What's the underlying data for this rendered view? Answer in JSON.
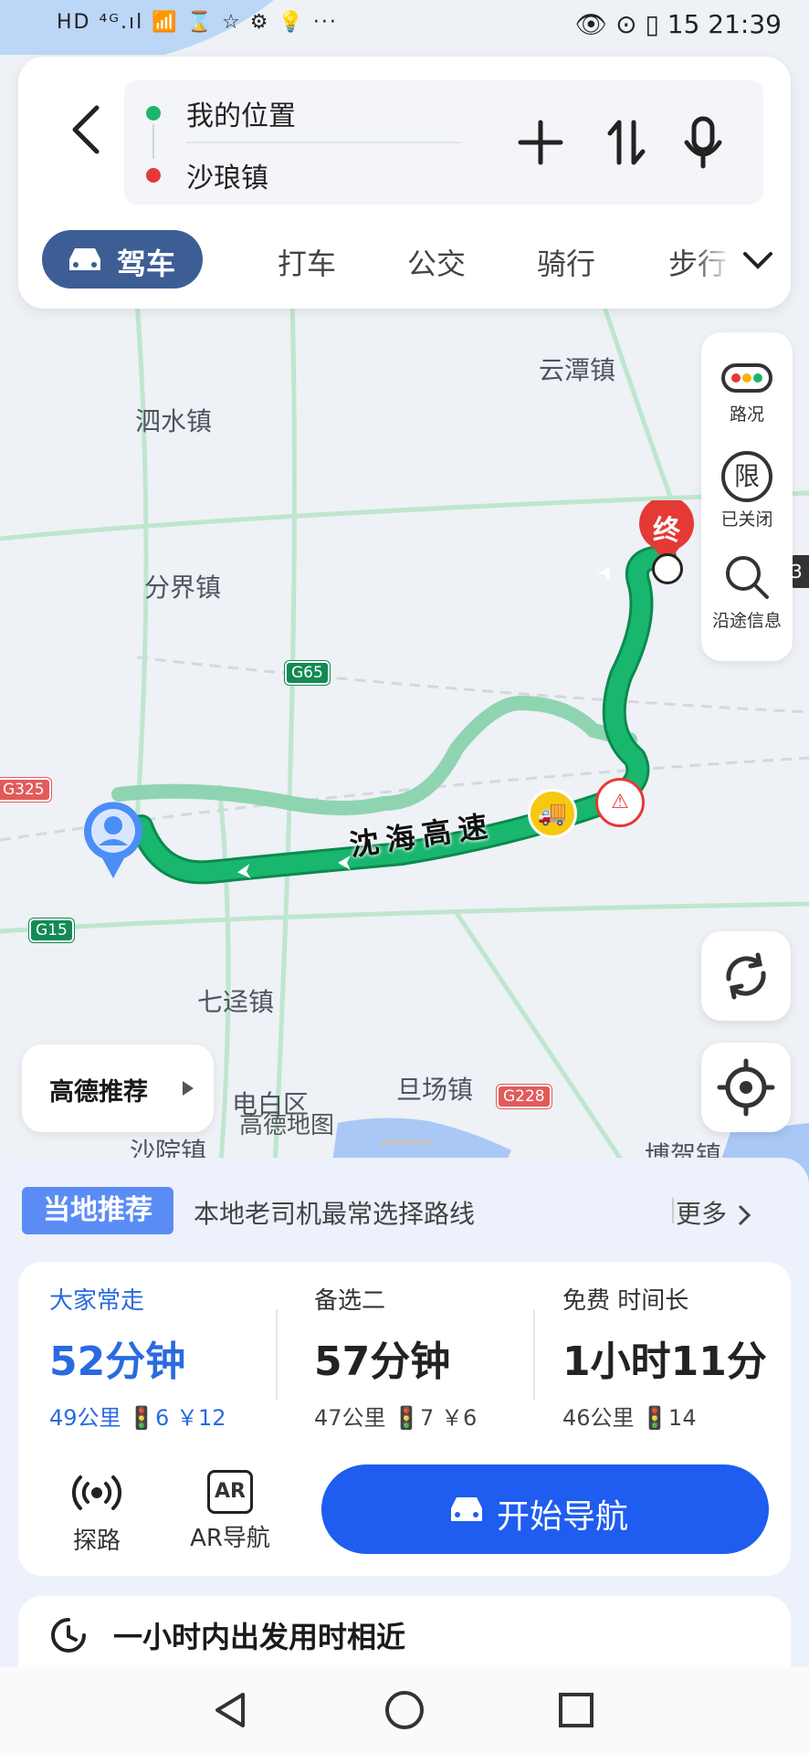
{
  "status_bar": {
    "left": "HD ⁴ᴳ.ıl 📶 ⌛ ☆ ⚙ 💡 ···",
    "right": "👁 ⊙ ▯ 15 21:39"
  },
  "search": {
    "origin": "我的位置",
    "destination": "沙琅镇",
    "origin_color": "#1db46a",
    "destination_color": "#e53935"
  },
  "modes": [
    "驾车",
    "打车",
    "公交",
    "骑行",
    "步行"
  ],
  "map": {
    "places": [
      "云潭镇",
      "泗水镇",
      "分界镇",
      "七迳镇",
      "电白区",
      "旦场镇",
      "沙院镇",
      "博贺镇"
    ],
    "watermark": "高德地图",
    "road_badges": [
      "G65",
      "G325",
      "G15",
      "G228"
    ],
    "highway_name": "沈海高速",
    "end_marker": "终",
    "side_edge_text": "3"
  },
  "side_tools": [
    {
      "icon": "traffic-light-icon",
      "label": "路况"
    },
    {
      "icon": "restriction-icon",
      "label": "已关闭",
      "glyph": "限"
    },
    {
      "icon": "search-icon",
      "label": "沿途信息"
    }
  ],
  "recommend_button": "高德推荐",
  "local": {
    "tag": "当地推荐",
    "desc": "本地老司机最常选择路线",
    "more": "更多"
  },
  "routes": [
    {
      "label": "大家常走",
      "time": "52分钟",
      "meta": "49公里 🚦6 ￥12",
      "active": true
    },
    {
      "label": "备选二",
      "time": "57分钟",
      "meta": "47公里 🚦7 ￥6",
      "active": false
    },
    {
      "label": "免费 时间长",
      "time": "1小时11分",
      "meta": "46公里 🚦14",
      "active": false
    }
  ],
  "tools": [
    {
      "icon": "probe-icon",
      "label": "探路"
    },
    {
      "icon": "ar-icon",
      "label": "AR导航",
      "glyph": "AR"
    }
  ],
  "start_nav": "开始导航",
  "hint": "一小时内出发用时相近",
  "colors": {
    "accent": "#1f5cf0",
    "route": "#16b06c",
    "tab_active": "#3c5e95"
  }
}
